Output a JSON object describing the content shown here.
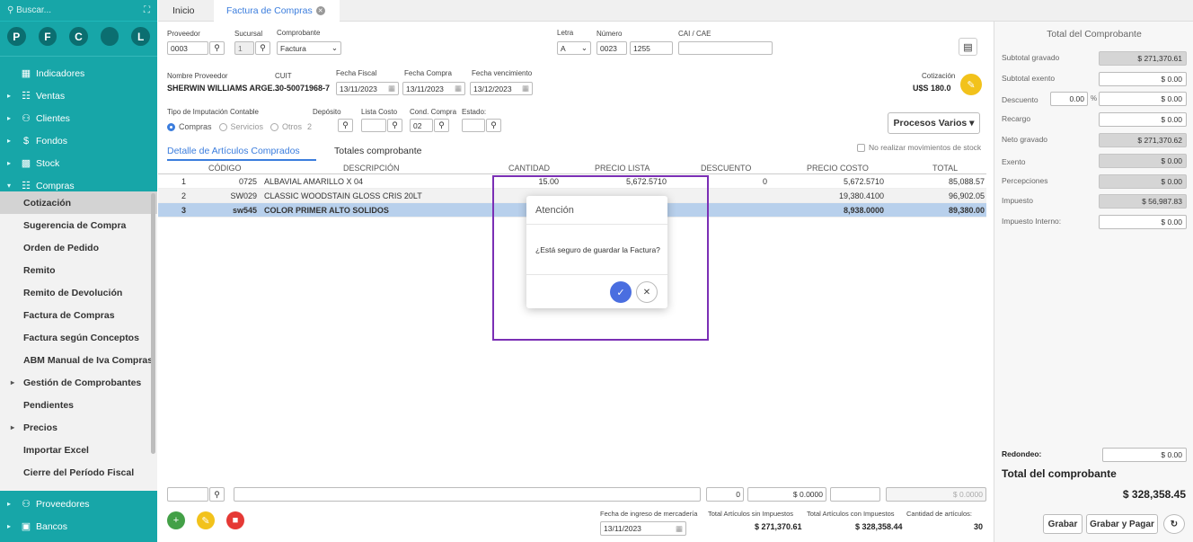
{
  "sidebar": {
    "search_placeholder": "Buscar...",
    "avatars": [
      "P",
      "F",
      "C",
      "",
      "L"
    ],
    "menu_top": [
      {
        "label": "Indicadores",
        "icon": "chart-icon"
      },
      {
        "label": "Ventas",
        "icon": "cart-icon"
      },
      {
        "label": "Clientes",
        "icon": "users-icon"
      },
      {
        "label": "Fondos",
        "icon": "dollar-icon"
      },
      {
        "label": "Stock",
        "icon": "box-icon"
      },
      {
        "label": "Compras",
        "icon": "cart-icon"
      }
    ],
    "submenu": [
      {
        "label": "Cotización"
      },
      {
        "label": "Sugerencia de Compra"
      },
      {
        "label": "Orden de Pedido"
      },
      {
        "label": "Remito"
      },
      {
        "label": "Remito de Devolución"
      },
      {
        "label": "Factura de Compras"
      },
      {
        "label": "Factura según Conceptos"
      },
      {
        "label": "ABM Manual de Iva Compras"
      },
      {
        "label": "Gestión de Comprobantes"
      },
      {
        "label": "Pendientes"
      },
      {
        "label": "Precios"
      },
      {
        "label": "Importar Excel"
      },
      {
        "label": "Cierre del Período Fiscal"
      }
    ],
    "menu_bottom": [
      {
        "label": "Proveedores",
        "icon": "users-icon"
      },
      {
        "label": "Bancos",
        "icon": "bank-icon"
      }
    ]
  },
  "tabs": {
    "inicio": "Inicio",
    "factura": "Factura de Compras"
  },
  "form": {
    "proveedor_label": "Proveedor",
    "proveedor": "0003",
    "sucursal_label": "Sucursal",
    "sucursal": "1",
    "comprobante_label": "Comprobante",
    "comprobante": "Factura",
    "letra_label": "Letra",
    "letra": "A",
    "numero_label": "Número",
    "numero_a": "0023",
    "numero_b": "1255",
    "cai_label": "CAI / CAE",
    "nombre_label": "Nombre Proveedor",
    "nombre": "SHERWIN WILLIAMS ARGE...",
    "cuit_label": "CUIT",
    "cuit": "30-50071968-7",
    "fecha_fiscal_label": "Fecha Fiscal",
    "fecha_fiscal": "13/11/2023",
    "fecha_compra_label": "Fecha Compra",
    "fecha_compra": "13/11/2023",
    "fecha_venc_label": "Fecha vencimiento",
    "fecha_venc": "13/12/2023",
    "cotizacion_label": "Cotización",
    "cotizacion": "U$S 180.0",
    "tipo_imp_label": "Tipo de Imputación Contable",
    "radio_compras": "Compras",
    "radio_servicios": "Servicios",
    "radio_otros": "Otros",
    "otros_val": "2",
    "deposito_label": "Depósito",
    "lista_costo_label": "Lista Costo",
    "cond_compra_label": "Cond. Compra",
    "cond_compra": "02",
    "estado_label": "Estado:",
    "procesos": "Procesos Varios",
    "no_stock": "No realizar movimientos de stock"
  },
  "subtabs": {
    "detalle": "Detalle de Artículos Comprados",
    "totales": "Totales comprobante"
  },
  "table": {
    "headers": [
      "CÓDIGO",
      "DESCRIPCIÓN",
      "CANTIDAD",
      "PRECIO LISTA",
      "DESCUENTO",
      "PRECIO COSTO",
      "TOTAL"
    ],
    "rows": [
      {
        "n": "1",
        "codigo": "0725",
        "desc": "ALBAVIAL AMARILLO X 04",
        "cant": "15.00",
        "lista": "5,672.5710",
        "desc_pct": "0",
        "costo": "5,672.5710",
        "total": "85,088.57"
      },
      {
        "n": "2",
        "codigo": "SW029",
        "desc": "CLASSIC WOODSTAIN GLOSS CRIS 20LT",
        "cant": "",
        "lista": "",
        "desc_pct": "",
        "costo": "19,380.4100",
        "total": "96,902.05"
      },
      {
        "n": "3",
        "codigo": "sw545",
        "desc": "COLOR PRIMER ALTO SOLIDOS",
        "cant": "",
        "lista": "",
        "desc_pct": "",
        "costo": "8,938.0000",
        "total": "89,380.00"
      }
    ]
  },
  "footer": {
    "qty": "0",
    "monto1": "$ 0.0000",
    "monto2": "$ 0.0000",
    "fecha_ingreso_label": "Fecha de ingreso de mercadería",
    "fecha_ingreso": "13/11/2023",
    "sin_imp_label": "Total Artículos sin Impuestos",
    "sin_imp": "$ 271,370.61",
    "con_imp_label": "Total Artículos con Impuestos",
    "con_imp": "$ 328,358.44",
    "cant_label": "Cantidad de artículos:",
    "cant": "30"
  },
  "totals": {
    "title": "Total del Comprobante",
    "subtotal_gravado_label": "Subtotal gravado",
    "subtotal_gravado": "$ 271,370.61",
    "subtotal_exento_label": "Subtotal exento",
    "subtotal_exento": "$ 0.00",
    "descuento_label": "Descuento",
    "descuento_pct": "0.00",
    "pct_sign": "%",
    "descuento": "$ 0.00",
    "recargo_label": "Recargo",
    "recargo": "$ 0.00",
    "neto_label": "Neto gravado",
    "neto": "$ 271,370.62",
    "exento_label": "Exento",
    "exento": "$ 0.00",
    "percepciones_label": "Percepciones",
    "percepciones": "$ 0.00",
    "impuesto_label": "Impuesto",
    "impuesto": "$ 56,987.83",
    "imp_interno_label": "Impuesto Interno:",
    "imp_interno": "$ 0.00",
    "redondeo_label": "Redondeo:",
    "redondeo": "$ 0.00",
    "total_label": "Total del comprobante",
    "total": "$ 328,358.45",
    "grabar": "Grabar",
    "grabar_pagar": "Grabar y Pagar"
  },
  "modal": {
    "title": "Atención",
    "message": "¿Está seguro de guardar la Factura?"
  },
  "colors": {
    "sidebar": "#17a6a8",
    "accent": "#3b7ddd",
    "highlight": "#7b2fb5",
    "yellow": "#f2c21b",
    "green": "#43a047",
    "red": "#e53935"
  }
}
